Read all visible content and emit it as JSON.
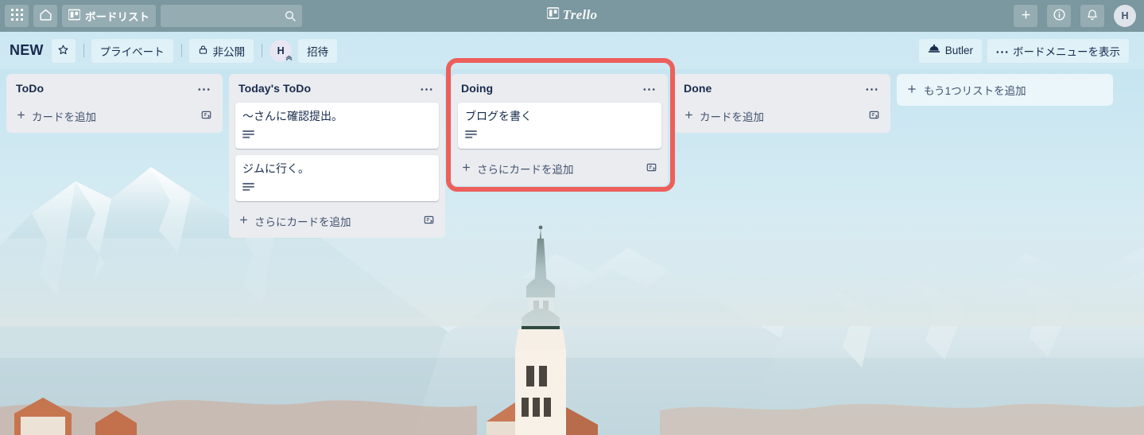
{
  "topbar": {
    "apps_label": "apps-grid",
    "home_label": "home",
    "boards_label": "ボードリスト",
    "search_value": "",
    "search_placeholder": "",
    "create_label": "+",
    "info_label": "i",
    "notifications_label": "bell",
    "avatar_initial": "H",
    "brand": "Trello"
  },
  "boardheader": {
    "title": "NEW",
    "star_label": "☆",
    "visibility_workspace": "プライベート",
    "visibility_private": "非公開",
    "member_initial": "H",
    "invite_label": "招待",
    "butler_label": "Butler",
    "menu_label": "ボードメニューを表示",
    "menu_dots": "…"
  },
  "lists": [
    {
      "name": "ToDo",
      "menu": "···",
      "cards": [],
      "add_card_label": "カードを追加"
    },
    {
      "name": "Today's ToDo",
      "menu": "···",
      "cards": [
        {
          "title": "〜さんに確認提出。",
          "has_description": true
        },
        {
          "title": "ジムに行く。",
          "has_description": true
        }
      ],
      "add_card_label": "さらにカードを追加"
    },
    {
      "name": "Doing",
      "menu": "···",
      "cards": [
        {
          "title": "ブログを書く",
          "has_description": true
        }
      ],
      "add_card_label": "さらにカードを追加"
    },
    {
      "name": "Done",
      "menu": "···",
      "cards": [],
      "add_card_label": "カードを追加"
    }
  ],
  "add_list": {
    "label": "もう1つリストを追加",
    "plus": "+"
  },
  "annotation": {
    "target_list": "Doing",
    "color": "#ec5f5b"
  },
  "colors": {
    "topbar": "#759099",
    "list_bg": "#ebecf0",
    "card_bg": "#ffffff",
    "text_primary": "#172b4d",
    "text_subtle": "#44546f",
    "highlight": "#ec5f5b"
  }
}
